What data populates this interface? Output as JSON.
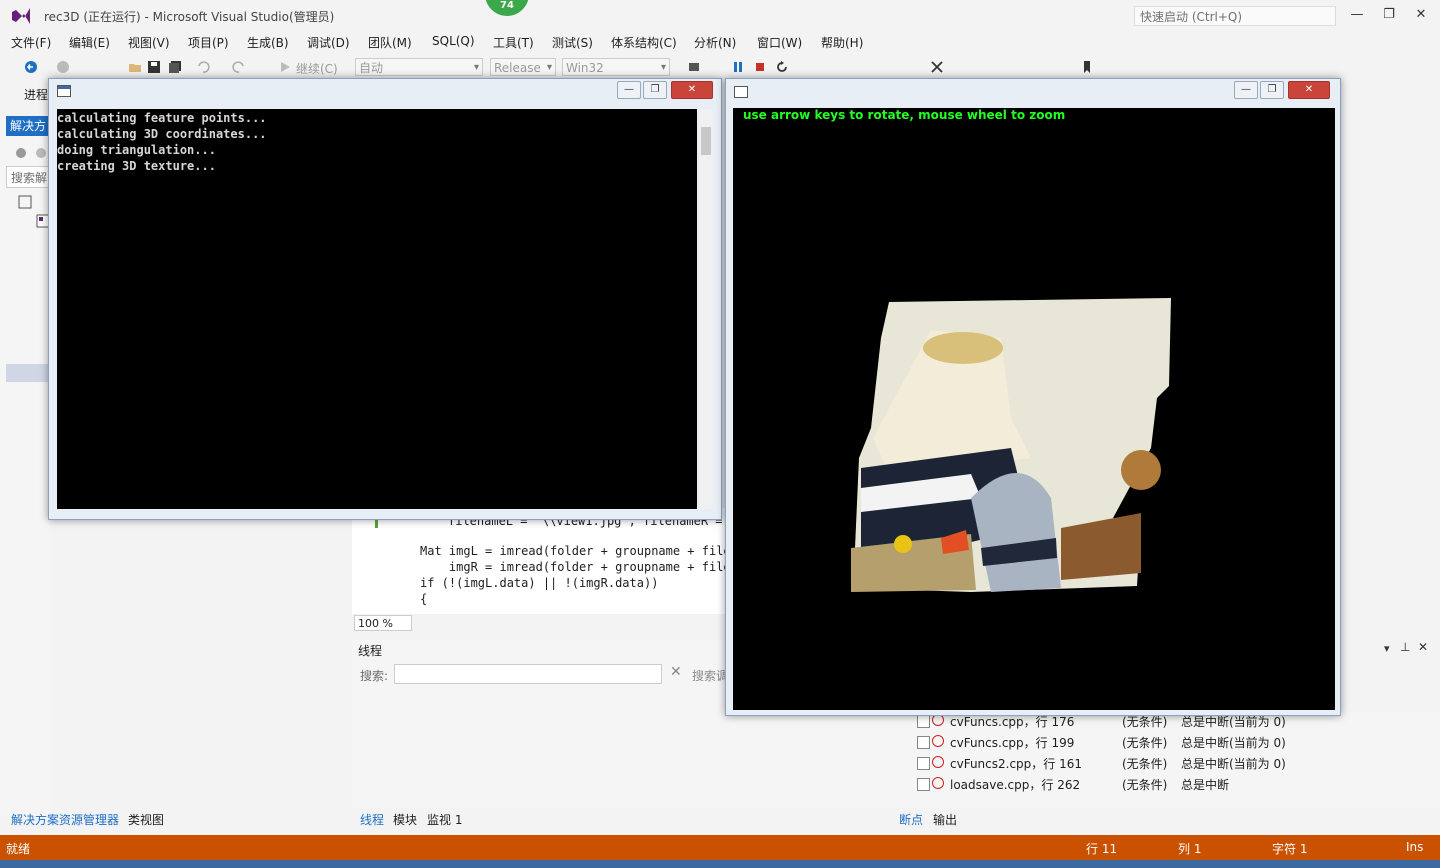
{
  "app": {
    "title": "rec3D (正在运行) - Microsoft Visual Studio(管理员)",
    "quick_launch_placeholder": "快速启动 (Ctrl+Q)",
    "notification_count": "74"
  },
  "menu": [
    "文件(F)",
    "编辑(E)",
    "视图(V)",
    "项目(P)",
    "生成(B)",
    "调试(D)",
    "团队(M)",
    "SQL(Q)",
    "工具(T)",
    "测试(S)",
    "体系结构(C)",
    "分析(N)",
    "窗口(W)",
    "帮助(H)"
  ],
  "toolbar": {
    "continue_label": "继续(C)",
    "config_combo": "自动",
    "build_config": "Release",
    "platform": "Win32",
    "process_label": "进程"
  },
  "left_panel": {
    "tab_label": "解决方案",
    "search_placeholder": "搜索解"
  },
  "code": {
    "lines": [
      "filenameL = \"\\\\view1.jpg\", filenameR =",
      "Mat imgL = imread(folder + groupname + filen",
      "    imgR = imread(folder + groupname + filen",
      "if (!(imgL.data) || !(imgR.data))",
      "{"
    ],
    "zoom": "100 %"
  },
  "threads": {
    "title": "线程",
    "search_label": "搜索:",
    "search_call": "搜索调"
  },
  "breakpoints": [
    {
      "name": "cvFuncs.cpp，行 176",
      "condition": "(无条件)",
      "hit": "总是中断(当前为 0)"
    },
    {
      "name": "cvFuncs.cpp，行 199",
      "condition": "(无条件)",
      "hit": "总是中断(当前为 0)"
    },
    {
      "name": "cvFuncs2.cpp，行 161",
      "condition": "(无条件)",
      "hit": "总是中断(当前为 0)"
    },
    {
      "name": "loadsave.cpp，行 262",
      "condition": "(无条件)",
      "hit": "总是中断"
    }
  ],
  "bottom_tabs": {
    "left": [
      "解决方案资源管理器",
      "类视图"
    ],
    "middle": [
      "线程",
      "模块",
      "监视 1"
    ],
    "right": [
      "断点",
      "输出"
    ]
  },
  "status": {
    "ready": "就绪",
    "line": "行 11",
    "col": "列 1",
    "char": "字符 1",
    "mode": "Ins"
  },
  "console": {
    "lines": [
      "calculating feature points...",
      "calculating 3D coordinates...",
      "doing triangulation...",
      "creating 3D texture..."
    ]
  },
  "viewer": {
    "hint": "use arrow keys to rotate, mouse wheel to zoom"
  },
  "colors": {
    "accent": "#1f6fc5",
    "status_bar": "#ca5100",
    "hint_text": "#22ff22",
    "breakpoint": "#d02020"
  }
}
